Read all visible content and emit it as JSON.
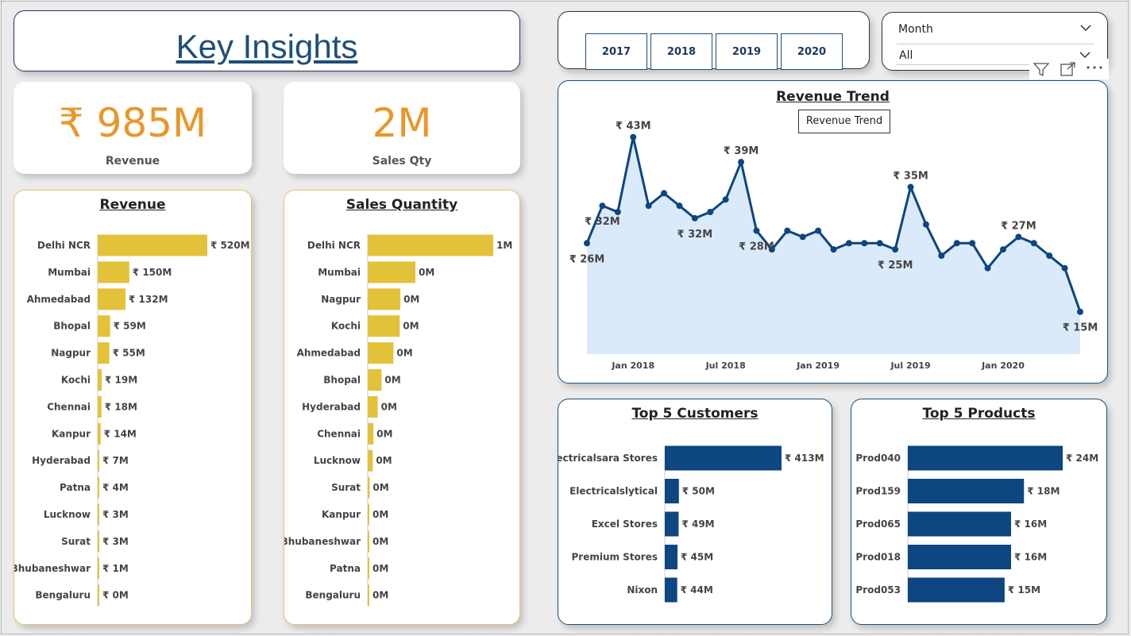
{
  "title": "Key Insights",
  "kpis": {
    "revenue": {
      "value": "₹ 985M",
      "label": "Revenue"
    },
    "sales_qty": {
      "value": "2M",
      "label": "Sales Qty"
    }
  },
  "year_slicer": {
    "years": [
      "2017",
      "2018",
      "2019",
      "2020"
    ]
  },
  "month_slicer": {
    "label": "Month",
    "selected": "All"
  },
  "colors": {
    "accent_orange": "#e8972a",
    "bar_yellow": "#e3c23a",
    "navy": "#0d4680",
    "area_fill": "#dbeafb"
  },
  "icons": [
    "filter-icon",
    "focus-mode-icon",
    "more-options-icon",
    "chevron-down-icon"
  ],
  "chart_data": [
    {
      "type": "bar",
      "title": "Revenue",
      "orientation": "horizontal",
      "categories": [
        "Delhi NCR",
        "Mumbai",
        "Ahmedabad",
        "Bhopal",
        "Nagpur",
        "Kochi",
        "Chennai",
        "Kanpur",
        "Hyderabad",
        "Patna",
        "Lucknow",
        "Surat",
        "Bhubaneshwar",
        "Bengaluru"
      ],
      "values": [
        520,
        150,
        132,
        59,
        55,
        19,
        18,
        14,
        7,
        4,
        3,
        3,
        1,
        0
      ],
      "labels": [
        "₹ 520M",
        "₹ 150M",
        "₹ 132M",
        "₹ 59M",
        "₹ 55M",
        "₹ 19M",
        "₹ 18M",
        "₹ 14M",
        "₹ 7M",
        "₹ 4M",
        "₹ 3M",
        "₹ 3M",
        "₹ 1M",
        "₹ 0M"
      ]
    },
    {
      "type": "bar",
      "title": "Sales Quantity",
      "orientation": "horizontal",
      "categories": [
        "Delhi NCR",
        "Mumbai",
        "Nagpur",
        "Kochi",
        "Ahmedabad",
        "Bhopal",
        "Hyderabad",
        "Chennai",
        "Lucknow",
        "Surat",
        "Kanpur",
        "Bhubaneshwar",
        "Patna",
        "Bengaluru"
      ],
      "values": [
        1000,
        380,
        260,
        255,
        205,
        110,
        80,
        45,
        40,
        15,
        10,
        6,
        4,
        3
      ],
      "labels": [
        "1M",
        "0M",
        "0M",
        "0M",
        "0M",
        "0M",
        "0M",
        "0M",
        "0M",
        "0M",
        "0M",
        "0M",
        "0M",
        "0M"
      ]
    },
    {
      "type": "area",
      "title": "Revenue Trend",
      "tooltip": "Revenue Trend",
      "x_ticks": [
        "Jan 2018",
        "Jul 2018",
        "Jan 2019",
        "Jul 2019",
        "Jan 2020"
      ],
      "x": [
        "2017-10",
        "2017-11",
        "2017-12",
        "2018-01",
        "2018-02",
        "2018-03",
        "2018-04",
        "2018-05",
        "2018-06",
        "2018-07",
        "2018-08",
        "2018-09",
        "2018-10",
        "2018-11",
        "2018-12",
        "2019-01",
        "2019-02",
        "2019-03",
        "2019-04",
        "2019-05",
        "2019-06",
        "2019-07",
        "2019-08",
        "2019-09",
        "2019-10",
        "2019-11",
        "2019-12",
        "2020-01",
        "2020-02",
        "2020-03",
        "2020-04",
        "2020-05",
        "2020-06"
      ],
      "values": [
        26,
        32,
        31,
        43,
        32,
        34,
        32,
        30,
        31,
        33,
        39,
        28,
        25,
        28,
        27,
        28,
        25,
        26,
        26,
        26,
        25,
        35,
        29,
        24,
        26,
        26,
        22,
        25,
        27,
        26,
        24,
        22,
        15
      ],
      "point_labels": [
        {
          "index": 0,
          "text": "₹ 26M"
        },
        {
          "index": 1,
          "text": "₹ 32M"
        },
        {
          "index": 3,
          "text": "₹ 43M"
        },
        {
          "index": 7,
          "text": "₹ 32M"
        },
        {
          "index": 10,
          "text": "₹ 39M"
        },
        {
          "index": 11,
          "text": "₹ 28M"
        },
        {
          "index": 20,
          "text": "₹ 25M"
        },
        {
          "index": 21,
          "text": "₹ 35M"
        },
        {
          "index": 28,
          "text": "₹ 27M"
        },
        {
          "index": 32,
          "text": "₹ 15M"
        }
      ]
    },
    {
      "type": "bar",
      "title": "Top 5 Customers",
      "orientation": "horizontal",
      "categories": [
        "Electricalsara Stores",
        "Electricalslytical",
        "Excel Stores",
        "Premium Stores",
        "Nixon"
      ],
      "values": [
        413,
        50,
        49,
        45,
        44
      ],
      "labels": [
        "₹ 413M",
        "₹ 50M",
        "₹ 49M",
        "₹ 45M",
        "₹ 44M"
      ]
    },
    {
      "type": "bar",
      "title": "Top 5 Products",
      "orientation": "horizontal",
      "categories": [
        "Prod040",
        "Prod159",
        "Prod065",
        "Prod018",
        "Prod053"
      ],
      "values": [
        24,
        18,
        16,
        16,
        15
      ],
      "labels": [
        "₹ 24M",
        "₹ 18M",
        "₹ 16M",
        "₹ 16M",
        "₹ 15M"
      ]
    }
  ]
}
